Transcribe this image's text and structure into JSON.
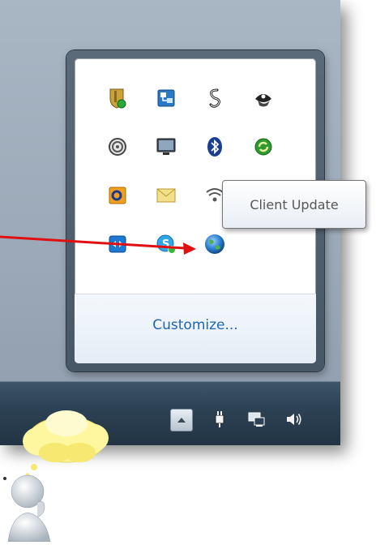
{
  "flyout": {
    "customize_label": "Customize...",
    "icons": [
      {
        "name": "security-shield-icon"
      },
      {
        "name": "network-map-icon"
      },
      {
        "name": "snake-chain-icon"
      },
      {
        "name": "pirate-hat-icon"
      },
      {
        "name": "spiral-disc-icon"
      },
      {
        "name": "monitor-icon"
      },
      {
        "name": "bluetooth-icon"
      },
      {
        "name": "sync-arrows-icon"
      },
      {
        "name": "office-outlook-icon"
      },
      {
        "name": "mail-envelope-icon"
      },
      {
        "name": "wifi-icon"
      },
      {
        "name": "teamviewer-icon"
      },
      {
        "name": "skype-icon"
      },
      {
        "name": "globe-icon"
      }
    ]
  },
  "tooltip": {
    "text": "Client Update"
  },
  "tray": {
    "icons": [
      "show-hidden-icons-button",
      "power-plug-icon",
      "network-icon",
      "volume-icon"
    ]
  },
  "colors": {
    "arrow": "#e01010",
    "link": "#1e64b4",
    "taskbar": "#2d4254"
  }
}
